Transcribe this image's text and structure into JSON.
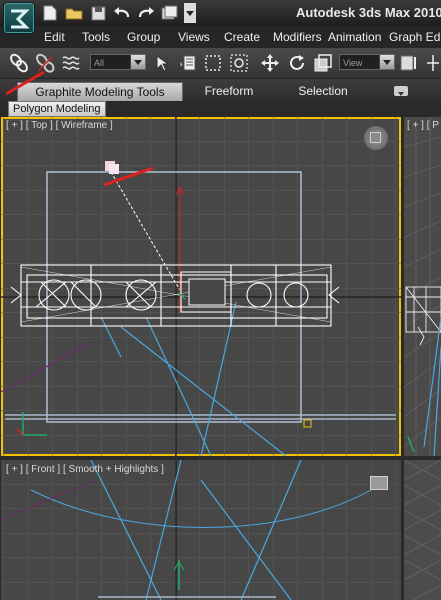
{
  "app": {
    "title": "Autodesk 3ds Max  2010"
  },
  "quick_access": [
    "new-file-icon",
    "open-folder-icon",
    "save-icon",
    "undo-icon",
    "redo-icon",
    "project-folder-icon",
    "dropdown-icon"
  ],
  "menu": {
    "items": [
      "Edit",
      "Tools",
      "Group",
      "Views",
      "Create",
      "Modifiers",
      "Animation",
      "Graph Editors"
    ]
  },
  "toolbar": {
    "selection_filter": "All",
    "reference_coord": "View"
  },
  "ribbon": {
    "tabs": [
      "Graphite Modeling Tools",
      "Freeform",
      "Selection"
    ],
    "active_panel": "Polygon Modeling"
  },
  "viewports": {
    "top": {
      "label": "[ + ] [ Top ] [ Wireframe ]"
    },
    "perspective": {
      "label": "[ + ] [ P"
    },
    "front": {
      "label": "[ + ] [ Front ] [ Smooth + Highlights ]"
    }
  },
  "colors": {
    "viewport_bg": "#474747",
    "grid": "#5a5a5a",
    "active_border": "#f2c200",
    "wireframe": "#ffffff",
    "light_cyan": "#4aa8e0"
  }
}
